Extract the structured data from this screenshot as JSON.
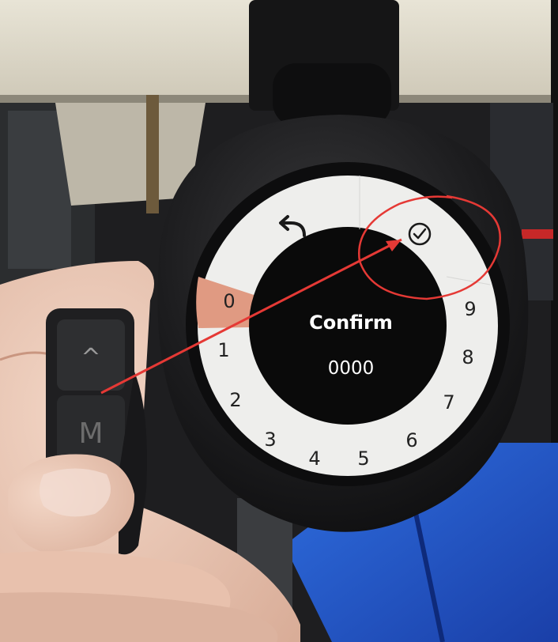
{
  "device": {
    "screen": {
      "title": "Confirm",
      "code": "0000",
      "dial_digits": [
        "0",
        "1",
        "2",
        "3",
        "4",
        "5",
        "6",
        "7",
        "8",
        "9"
      ],
      "selected_digit": "0",
      "back_icon": "back-arrow-icon",
      "confirm_icon": "check-circle-icon"
    },
    "remote": {
      "up_button_glyph": "^",
      "mode_button_label": "M"
    }
  },
  "annotation": {
    "type": "arrow-and-circle",
    "color": "#e53935",
    "from": "remote-mode-button",
    "to": "confirm-check-icon"
  },
  "colors": {
    "dial_ring": "#eeeeec",
    "screen_center": "#0a0a0a",
    "selected_segment": "#e09a82",
    "text_white": "#ffffff",
    "text_dark": "#222222"
  }
}
